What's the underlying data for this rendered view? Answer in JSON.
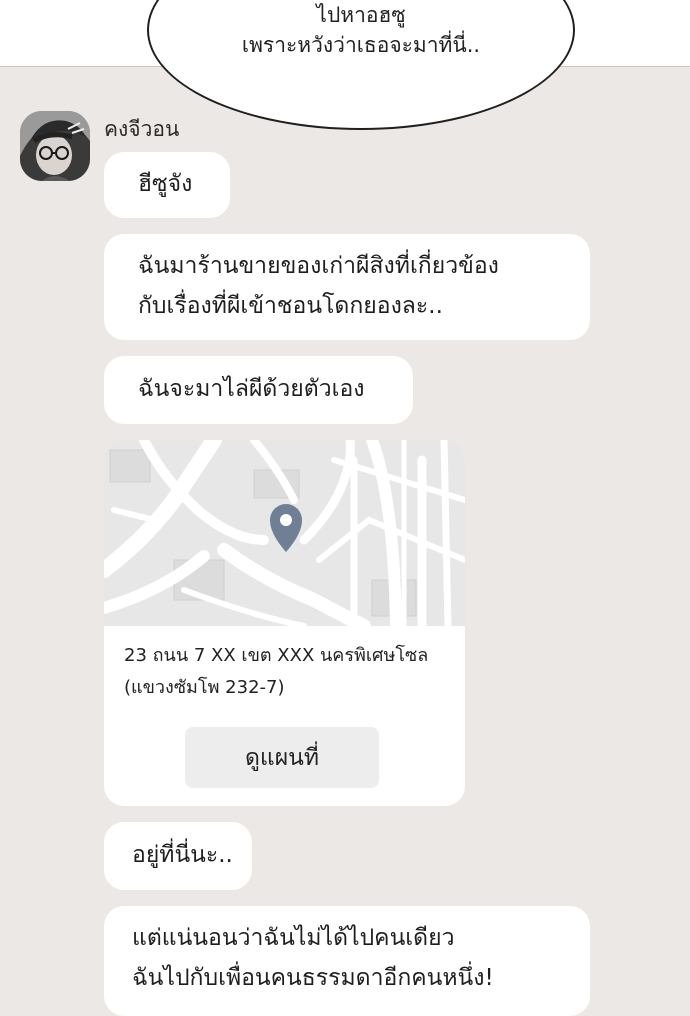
{
  "speech_bubble": {
    "lines": [
      "ไปหาอฮซู",
      "เพราะหวังว่าเธอจะมาที่นี่.."
    ]
  },
  "chat": {
    "sender_name": "คงจีวอน",
    "messages": [
      {
        "lines": [
          "ฮีซูจัง"
        ]
      },
      {
        "lines": [
          "ฉันมาร้านขายของเก่าผีสิงที่เกี่ยวข้อง",
          "กับเรื่องที่ผีเข้าชอนโดกยองละ.."
        ]
      },
      {
        "lines": [
          "ฉันจะมาไล่ผีด้วยตัวเอง"
        ]
      },
      {
        "lines": [
          "อยู่ที่นี่นะ.."
        ]
      },
      {
        "lines": [
          "แต่แน่นอนว่าฉันไม่ได้ไปคนเดียว",
          "ฉันไปกับเพื่อนคนธรรมดาอีกคนหนึ่ง!"
        ]
      }
    ],
    "location_card": {
      "address_lines": [
        "23 ถนน 7 XX เขต XXX นครพิเศษโซล",
        "(แขวงซัมโพ 232-7)"
      ],
      "button_label": "ดูแผนที่"
    }
  },
  "colors": {
    "background": "#ece8e6",
    "bubble": "#ffffff",
    "pin": "#6f7f95",
    "map_road": "#ffffff",
    "map_land": "#e7e7e7"
  }
}
